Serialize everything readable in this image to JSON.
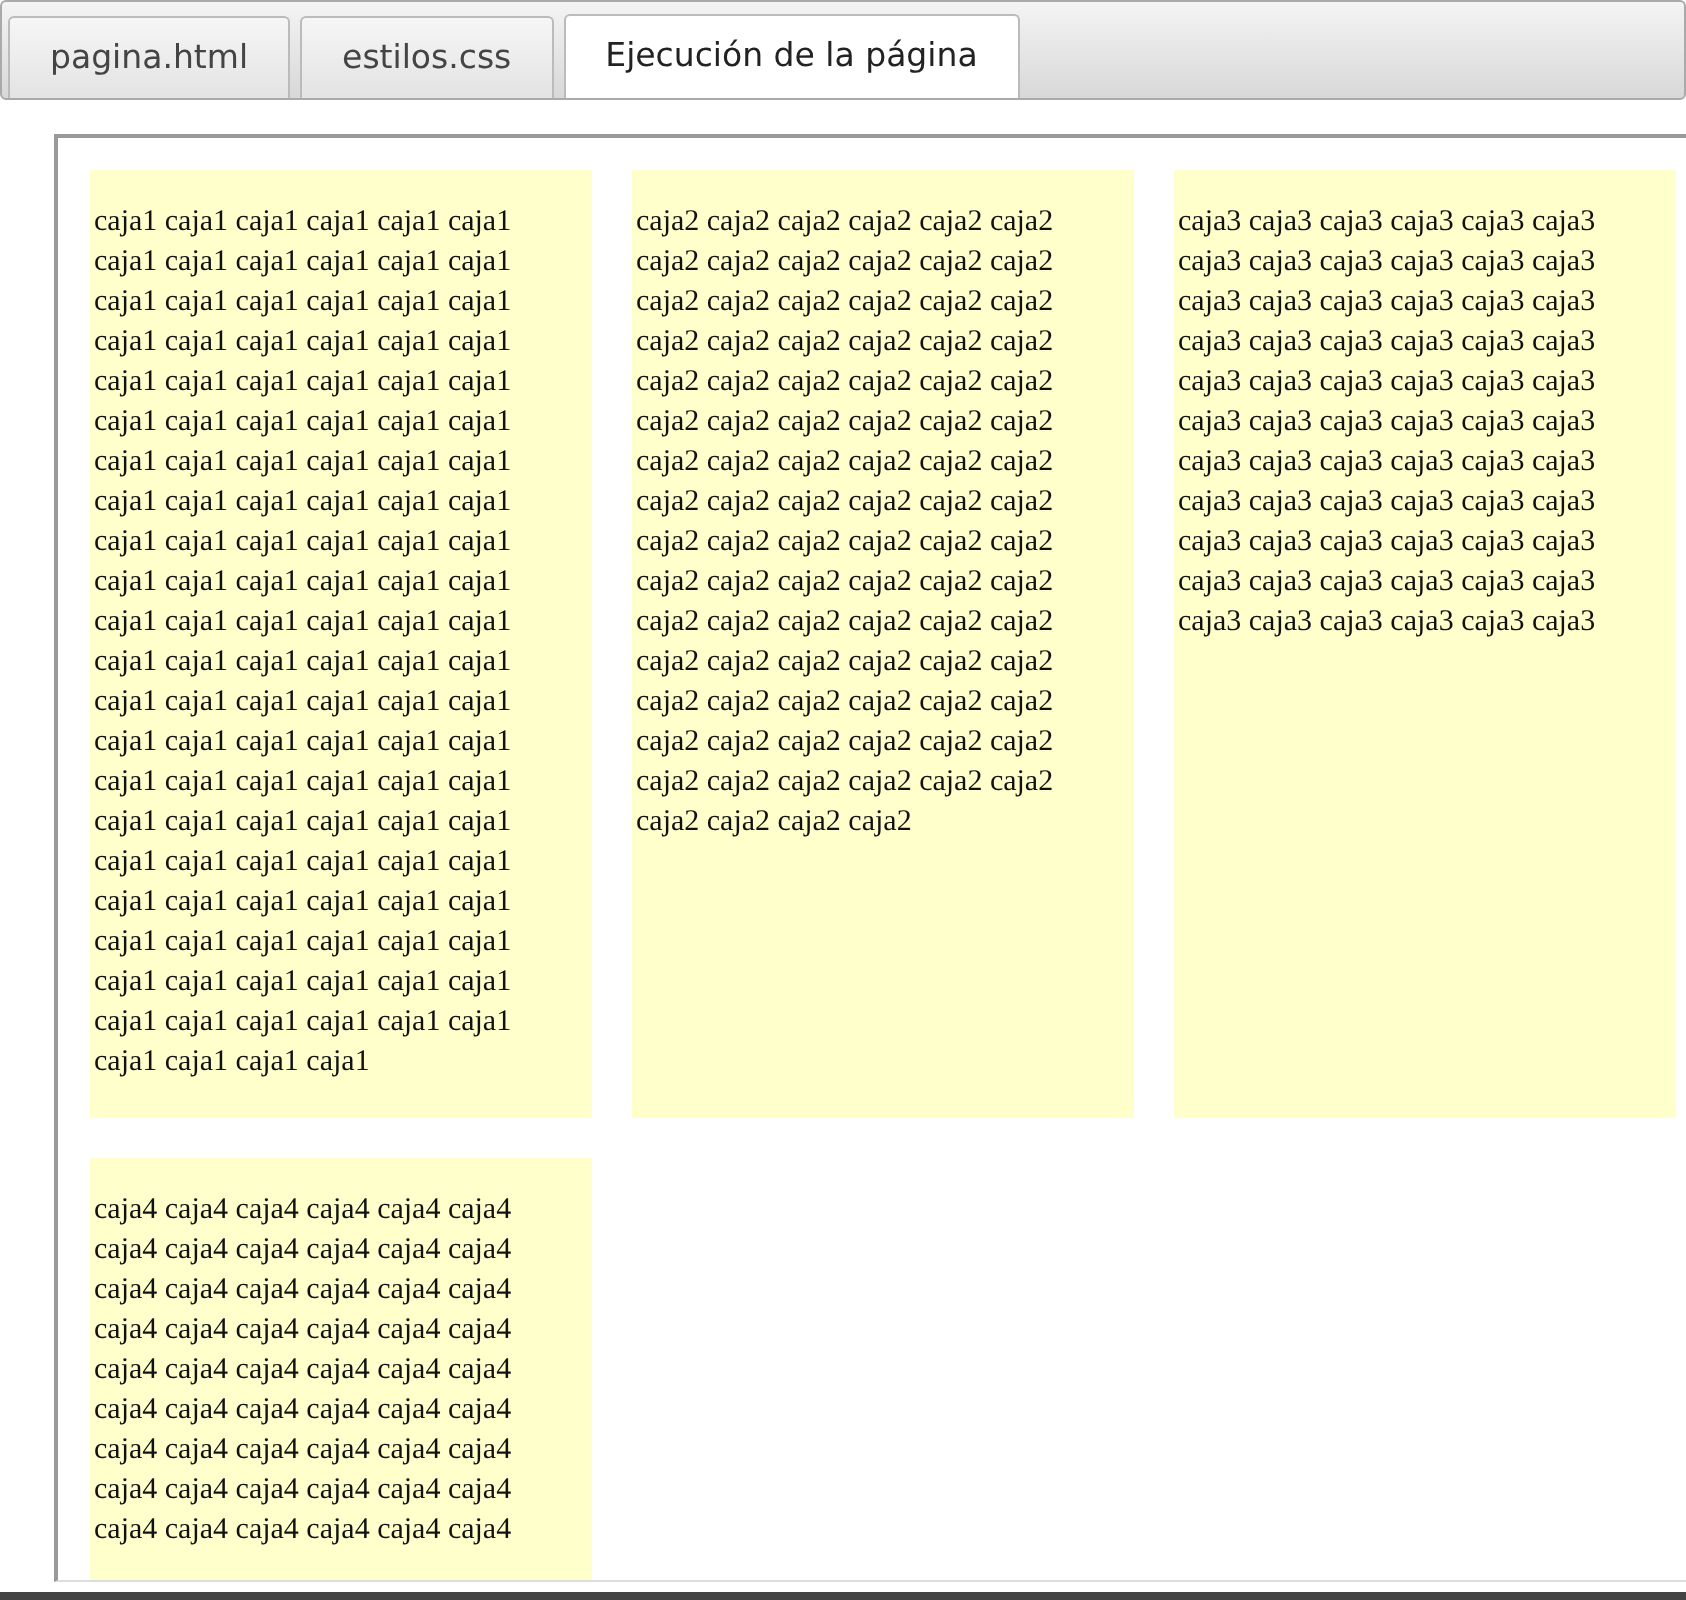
{
  "tabs": [
    {
      "label": "pagina.html",
      "selected": false
    },
    {
      "label": "estilos.css",
      "selected": false
    },
    {
      "label": "Ejecución de la página",
      "selected": true
    }
  ],
  "boxes": [
    {
      "text": "caja1 caja1 caja1 caja1 caja1 caja1 caja1 caja1 caja1 caja1 caja1 caja1 caja1 caja1 caja1 caja1 caja1 caja1 caja1 caja1 caja1 caja1 caja1 caja1 caja1 caja1 caja1 caja1 caja1 caja1 caja1 caja1 caja1 caja1 caja1 caja1 caja1 caja1 caja1 caja1 caja1 caja1 caja1 caja1 caja1 caja1 caja1 caja1 caja1 caja1 caja1 caja1 caja1 caja1 caja1 caja1 caja1 caja1 caja1 caja1 caja1 caja1 caja1 caja1 caja1 caja1 caja1 caja1 caja1 caja1 caja1 caja1 caja1 caja1 caja1 caja1 caja1 caja1 caja1 caja1 caja1 caja1 caja1 caja1 caja1 caja1 caja1 caja1 caja1 caja1 caja1 caja1 caja1 caja1 caja1 caja1 caja1 caja1 caja1 caja1 caja1 caja1 caja1 caja1 caja1 caja1 caja1 caja1 caja1 caja1 caja1 caja1 caja1 caja1 caja1 caja1 caja1 caja1 caja1 caja1 caja1 caja1 caja1 caja1 caja1 caja1 caja1 caja1 caja1 caja1"
    },
    {
      "text": "caja2 caja2 caja2 caja2 caja2 caja2 caja2 caja2 caja2 caja2 caja2 caja2 caja2 caja2 caja2 caja2 caja2 caja2 caja2 caja2 caja2 caja2 caja2 caja2 caja2 caja2 caja2 caja2 caja2 caja2 caja2 caja2 caja2 caja2 caja2 caja2 caja2 caja2 caja2 caja2 caja2 caja2 caja2 caja2 caja2 caja2 caja2 caja2 caja2 caja2 caja2 caja2 caja2 caja2 caja2 caja2 caja2 caja2 caja2 caja2 caja2 caja2 caja2 caja2 caja2 caja2 caja2 caja2 caja2 caja2 caja2 caja2 caja2 caja2 caja2 caja2 caja2 caja2 caja2 caja2 caja2 caja2 caja2 caja2 caja2 caja2 caja2 caja2 caja2 caja2 caja2 caja2 caja2 caja2"
    },
    {
      "text": "caja3 caja3 caja3 caja3 caja3 caja3 caja3 caja3 caja3 caja3 caja3 caja3 caja3 caja3 caja3 caja3 caja3 caja3 caja3 caja3 caja3 caja3 caja3 caja3 caja3 caja3 caja3 caja3 caja3 caja3 caja3 caja3 caja3 caja3 caja3 caja3 caja3 caja3 caja3 caja3 caja3 caja3 caja3 caja3 caja3 caja3 caja3 caja3 caja3 caja3 caja3 caja3 caja3 caja3 caja3 caja3 caja3 caja3 caja3 caja3 caja3 caja3 caja3 caja3 caja3 caja3"
    },
    {
      "text": "caja4 caja4 caja4 caja4 caja4 caja4 caja4 caja4 caja4 caja4 caja4 caja4 caja4 caja4 caja4 caja4 caja4 caja4 caja4 caja4 caja4 caja4 caja4 caja4 caja4 caja4 caja4 caja4 caja4 caja4 caja4 caja4 caja4 caja4 caja4 caja4 caja4 caja4 caja4 caja4 caja4 caja4 caja4 caja4 caja4 caja4 caja4 caja4 caja4 caja4 caja4 caja4 caja4 caja4"
    }
  ]
}
